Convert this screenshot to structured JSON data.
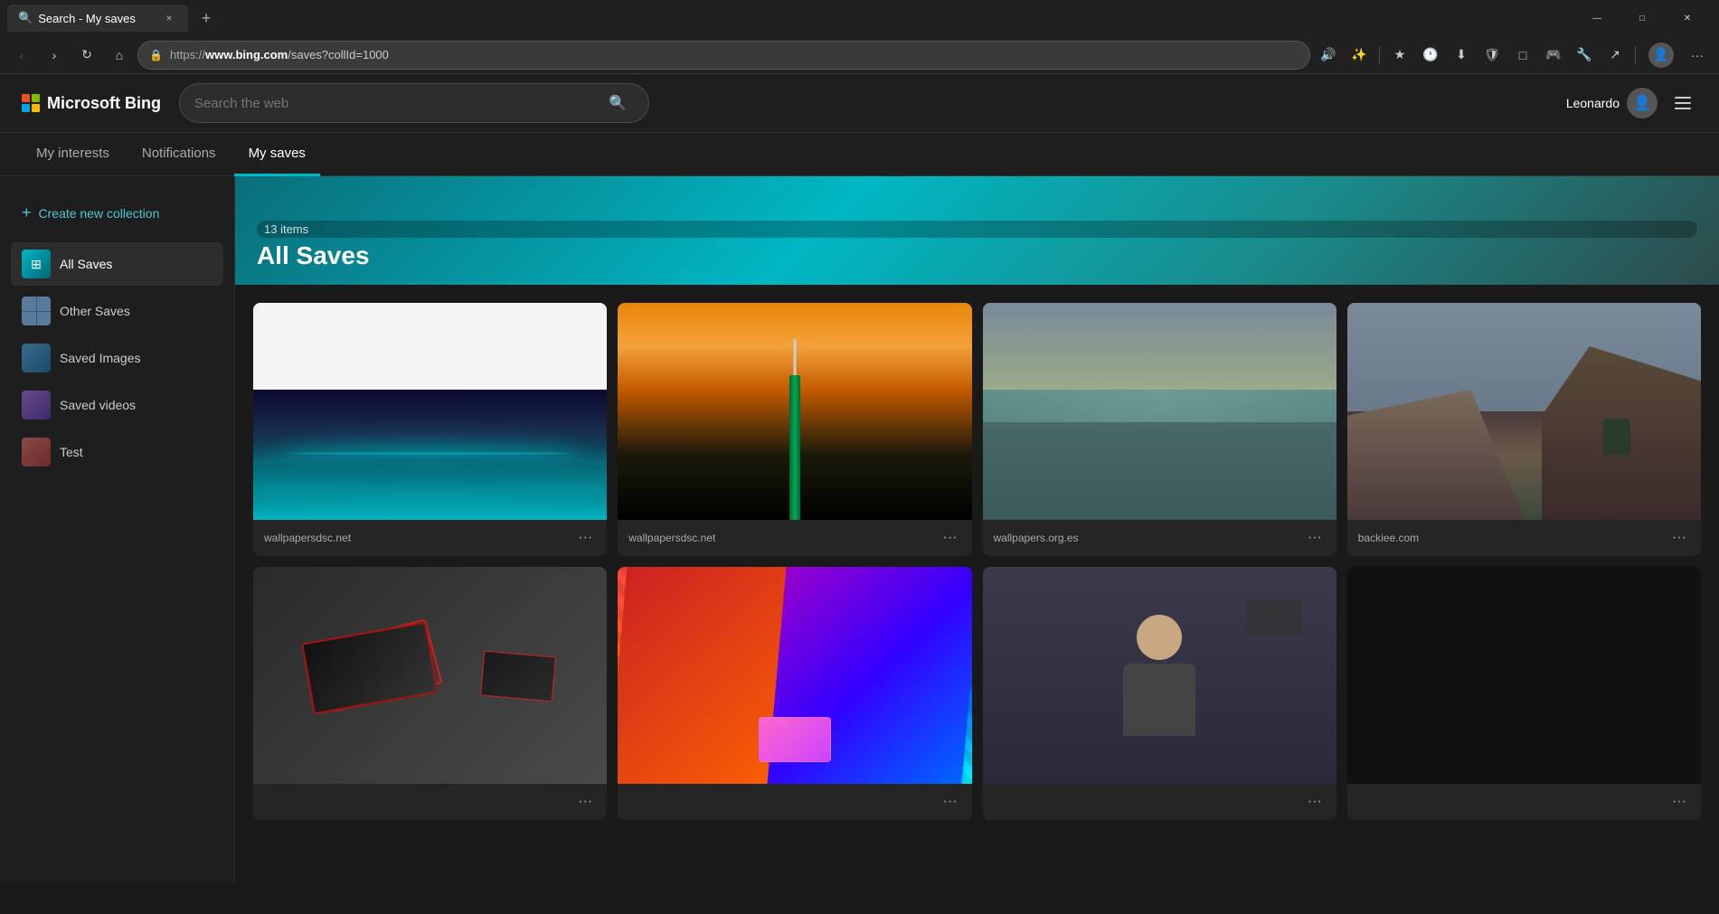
{
  "browser": {
    "tab": {
      "title": "Search - My saves",
      "favicon": "🔍",
      "close_label": "×",
      "new_tab_label": "+"
    },
    "window_controls": {
      "minimize": "—",
      "maximize": "□",
      "close": "✕"
    },
    "address_bar": {
      "url_prefix": "https://",
      "url_host": "www.bing.com",
      "url_path": "/saves?collId=1000"
    },
    "nav": {
      "back": "‹",
      "forward": "›",
      "refresh": "↻",
      "home": "⌂"
    }
  },
  "bing": {
    "logo_text": "Microsoft Bing",
    "search_placeholder": "Search the web",
    "user_name": "Leonardo",
    "nav_tabs": [
      {
        "id": "interests",
        "label": "My interests"
      },
      {
        "id": "notifications",
        "label": "Notifications"
      },
      {
        "id": "my-saves",
        "label": "My saves"
      }
    ]
  },
  "sidebar": {
    "create_btn_label": "Create new collection",
    "create_icon": "+",
    "items": [
      {
        "id": "all-saves",
        "label": "All Saves",
        "active": true,
        "icon_type": "all"
      },
      {
        "id": "other-saves",
        "label": "Other Saves",
        "active": false,
        "icon_type": "other"
      },
      {
        "id": "saved-images",
        "label": "Saved Images",
        "active": false,
        "icon_type": "images"
      },
      {
        "id": "saved-videos",
        "label": "Saved videos",
        "active": false,
        "icon_type": "videos"
      },
      {
        "id": "test",
        "label": "Test",
        "active": false,
        "icon_type": "test"
      }
    ]
  },
  "collection": {
    "title": "All Saves",
    "items_count": "13 items"
  },
  "cards": [
    {
      "id": 1,
      "source": "wallpapersdsc.net",
      "img_type": "earth",
      "menu": "···"
    },
    {
      "id": 2,
      "source": "wallpapersdsc.net",
      "img_type": "tower",
      "menu": "···"
    },
    {
      "id": 3,
      "source": "wallpapers.org.es",
      "img_type": "coast",
      "menu": "···"
    },
    {
      "id": 4,
      "source": "backiee.com",
      "img_type": "rocks",
      "menu": "···"
    },
    {
      "id": 5,
      "source": "",
      "img_type": "gadgets",
      "menu": "···"
    },
    {
      "id": 6,
      "source": "",
      "img_type": "colorful",
      "menu": "···"
    },
    {
      "id": 7,
      "source": "",
      "img_type": "person",
      "menu": "···"
    },
    {
      "id": 8,
      "source": "",
      "img_type": "dark",
      "menu": "···"
    }
  ]
}
